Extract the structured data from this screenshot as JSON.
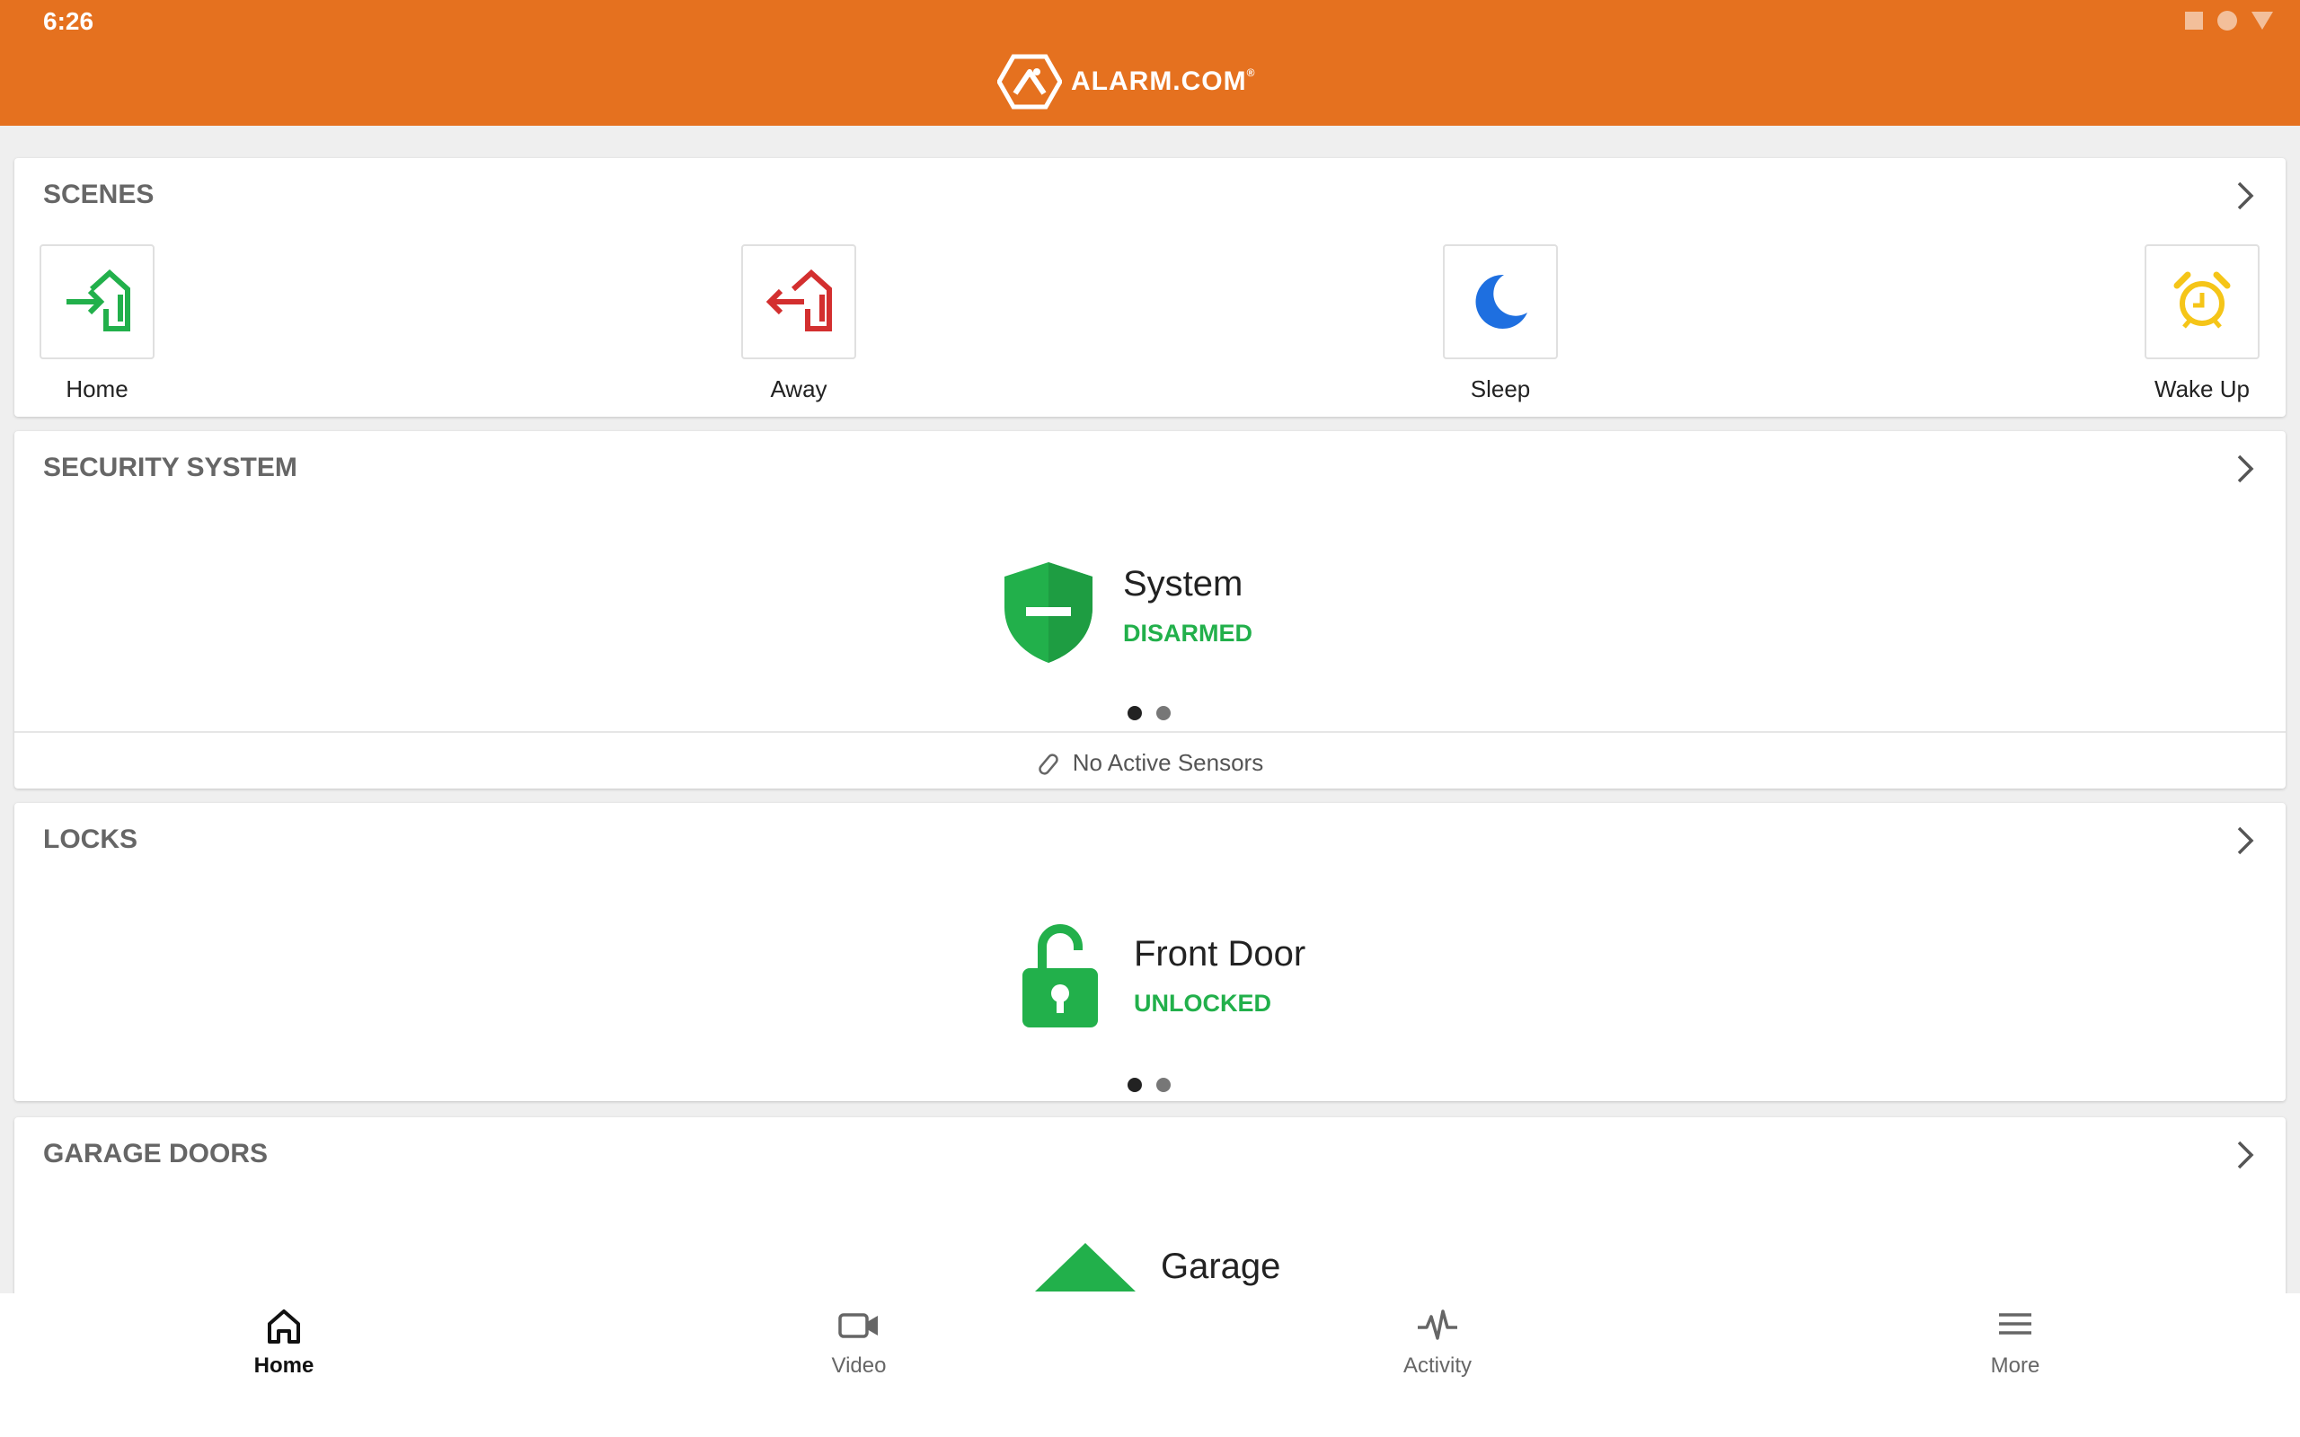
{
  "status_bar": {
    "time": "6:26"
  },
  "header": {
    "brand": "ALARM.COM",
    "brand_mark": "®"
  },
  "scenes": {
    "title": "SCENES",
    "items": [
      {
        "label": "Home",
        "icon": "arrive-home-icon",
        "color": "#22b04b"
      },
      {
        "label": "Away",
        "icon": "leave-home-icon",
        "color": "#d32f2f"
      },
      {
        "label": "Sleep",
        "icon": "moon-icon",
        "color": "#1e6fe0"
      },
      {
        "label": "Wake Up",
        "icon": "alarm-clock-icon",
        "color": "#f5c518"
      }
    ]
  },
  "security": {
    "title": "SECURITY SYSTEM",
    "device": "System",
    "status": "DISARMED",
    "sensors": "No Active Sensors"
  },
  "locks": {
    "title": "LOCKS",
    "device": "Front Door",
    "status": "UNLOCKED"
  },
  "garage": {
    "title": "GARAGE DOORS",
    "device": "Garage"
  },
  "nav": {
    "items": [
      {
        "label": "Home",
        "icon": "home-icon",
        "active": true
      },
      {
        "label": "Video",
        "icon": "video-camera-icon"
      },
      {
        "label": "Activity",
        "icon": "activity-icon"
      },
      {
        "label": "More",
        "icon": "menu-icon"
      }
    ]
  },
  "colors": {
    "accent": "#e5711f",
    "success": "#22b04b"
  }
}
